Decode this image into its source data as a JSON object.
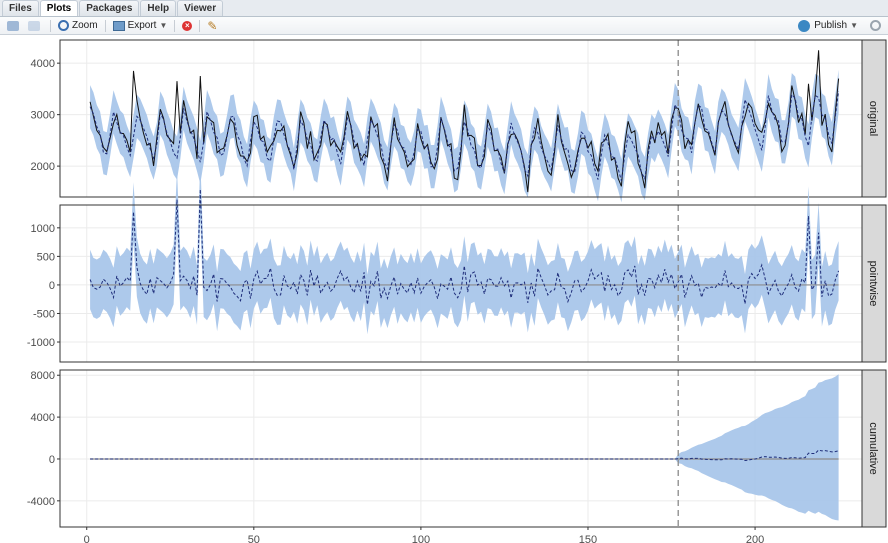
{
  "tabs": [
    {
      "label": "Files"
    },
    {
      "label": "Plots"
    },
    {
      "label": "Packages"
    },
    {
      "label": "Help"
    },
    {
      "label": "Viewer"
    }
  ],
  "toolbar": {
    "zoom_label": "Zoom",
    "export_label": "Export",
    "publish_label": "Publish"
  },
  "colors": {
    "band": "#a9c6ea",
    "pred": "#1f2e7a",
    "obs": "#111111",
    "zero": "#8c8c8c",
    "grid": "#ebebeb",
    "strip": "#d9d9d9"
  },
  "chart_data": {
    "type": "line",
    "x_axis": {
      "ticks": [
        0,
        50,
        100,
        150,
        200
      ],
      "range": [
        -8,
        232
      ]
    },
    "intervention_x": 177,
    "n_points": 225,
    "panels": [
      {
        "name": "original",
        "yticks": [
          2000,
          3000,
          4000
        ],
        "ylim": [
          1400,
          4450
        ],
        "series": [
          "observed",
          "predicted",
          "interval"
        ]
      },
      {
        "name": "pointwise",
        "yticks": [
          -1000,
          -500,
          0,
          500,
          1000
        ],
        "ylim": [
          -1350,
          1400
        ],
        "series": [
          "predicted",
          "interval",
          "zero-line"
        ]
      },
      {
        "name": "cumulative",
        "yticks": [
          -4000,
          0,
          4000,
          8000
        ],
        "ylim": [
          -6500,
          8500
        ],
        "series": [
          "predicted",
          "interval",
          "zero-line"
        ]
      }
    ]
  }
}
